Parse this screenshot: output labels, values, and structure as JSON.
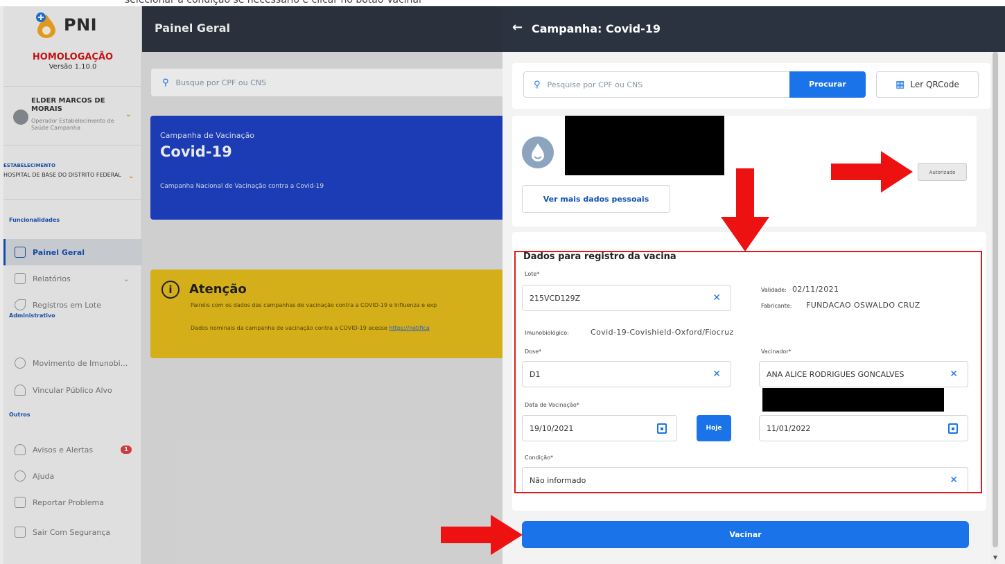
{
  "caption": "selecionar a condição se necessário e clicar no botão Vacinar",
  "sidebar": {
    "logo": "PNI",
    "environment": "HOMOLOGAÇÃO",
    "version": "Versão 1.10.0",
    "user_name": "ELDER MARCOS DE MORAIS",
    "user_role": "Operador Estabelecimento de Saúde Campanha",
    "estab_label": "ESTABELECIMENTO",
    "estab_value": "HOSPITAL DE BASE DO DISTRITO FEDERAL",
    "section_funcionalidades": "Funcionalidades",
    "section_administrativo": "Administrativo",
    "section_outros": "Outros",
    "items": {
      "painel": "Painel Geral",
      "relatorios": "Relatórios",
      "registros": "Registros em Lote",
      "movimento": "Movimento de Imunobi...",
      "vincular": "Vincular Público Alvo",
      "avisos": "Avisos e Alertas",
      "avisos_count": "1",
      "ajuda": "Ajuda",
      "reportar": "Reportar Problema",
      "sair": "Sair Com Segurança"
    }
  },
  "main": {
    "title": "Painel Geral",
    "search_placeholder": "Busque por CPF ou CNS",
    "campaign_sub": "Campanha de Vacinação",
    "campaign_title": "Covid-19",
    "campaign_desc": "Campanha Nacional de Vacinação contra a Covid-19",
    "warning_title": "Atenção",
    "warning_line1": "Painéis com os dados das campanhas de vacinação contra a COVID-19 e Influenza e exp",
    "warning_line2": "Dados nominais da campanha de vacinação contra a COVID-19 acesse",
    "warning_link": "https://notifica"
  },
  "panel": {
    "title": "Campanha: Covid-19",
    "search_placeholder": "Pesquise por CPF ou CNS",
    "search_button": "Procurar",
    "qr_button": "Ler QRCode",
    "more_data_button": "Ver mais dados pessoais",
    "auth_badge": "Autorizado",
    "form": {
      "heading": "Dados para registro da vacina",
      "lote_label": "Lote*",
      "lote_value": "215VCD129Z",
      "validade_label": "Validade:",
      "validade_value": "02/11/2021",
      "fabricante_label": "Fabricante:",
      "fabricante_value": "FUNDACAO OSWALDO CRUZ",
      "imuno_label": "Imunobiológico:",
      "imuno_value": "Covid-19-Covishield-Oxford/Fiocruz",
      "dose_label": "Dose*",
      "dose_value": "D1",
      "vacinador_label": "Vacinador*",
      "vacinador_value": "ANA ALICE RODRIGUES GONCALVES",
      "data_label": "Data de Vacinação*",
      "data_value": "19/10/2021",
      "hoje_button": "Hoje",
      "aprazamento_value": "11/01/2022",
      "condicao_label": "Condição*",
      "condicao_value": "Não informado"
    },
    "vacinar_button": "Vacinar"
  },
  "colors": {
    "topbar": "#2b3340",
    "primary": "#1a73e8",
    "campaign_card": "#1a3fc4",
    "warning_card": "#e8bf18",
    "highlight_red": "#e01a1a",
    "env_red": "#d31313"
  }
}
